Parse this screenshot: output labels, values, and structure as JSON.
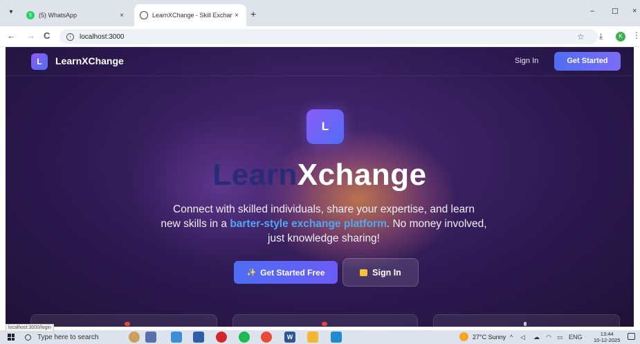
{
  "browser": {
    "tabs": [
      {
        "title": "(5) WhatsApp",
        "close": "×"
      },
      {
        "title": "LearnXChange - Skill Exchange",
        "close": "×"
      }
    ],
    "new_tab": "+",
    "window_controls": {
      "minimize": "–",
      "maximize": "☐",
      "close": "×"
    },
    "nav": {
      "back": "←",
      "forward": "→",
      "reload": "C"
    },
    "url": "localhost:3000",
    "profile_initial": "K"
  },
  "site": {
    "logo_letter": "L",
    "brand": "LearnXChange",
    "nav": {
      "signin": "Sign In",
      "get_started": "Get Started"
    },
    "hero": {
      "logo_letter": "L",
      "title_part1": "Learn",
      "title_part2": "Xchange",
      "desc_line1": "Connect with skilled individuals, share your expertise, and learn",
      "desc_pre": "new skills in a ",
      "desc_highlight": "barter-style exchange platform",
      "desc_post": ". No money involved,",
      "desc_line3": "just knowledge sharing!",
      "cta_primary": "Get Started Free",
      "cta_secondary": "Sign In"
    },
    "colors": {
      "accent": "#4f6df5",
      "highlight": "#4fa8f5",
      "background": "#2d1a52"
    }
  },
  "status_link": "localhost:3000/login",
  "taskbar": {
    "search_placeholder": "Type here to search",
    "word_icon_letter": "W",
    "weather": "27°C  Sunny",
    "lang": "ENG",
    "time": "13:44",
    "date": "10-12-2025"
  }
}
